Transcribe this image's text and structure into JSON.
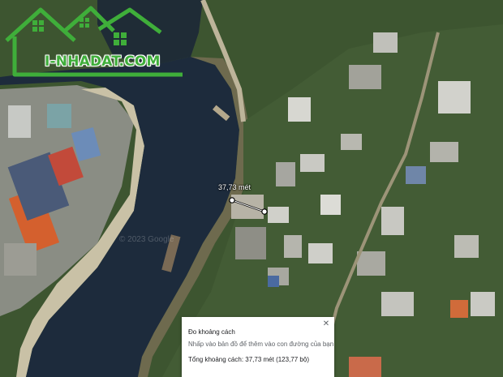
{
  "brand": {
    "logo_text": "I-NHADAT.COM"
  },
  "measurement": {
    "distance_label": "37,73 mét"
  },
  "map_watermark": "© 2023 Google",
  "popup": {
    "title": "Đo khoảng cách",
    "instruction": "Nhấp vào bản đồ để thêm vào con đường của bạn",
    "total": "Tổng khoảng cách: 37,73 mét (123,77 bộ)",
    "close_symbol": "✕"
  },
  "colors": {
    "brand_green": "#3fae3a",
    "river": "#1d2b3c",
    "vegetation": "#3f5a2e"
  }
}
